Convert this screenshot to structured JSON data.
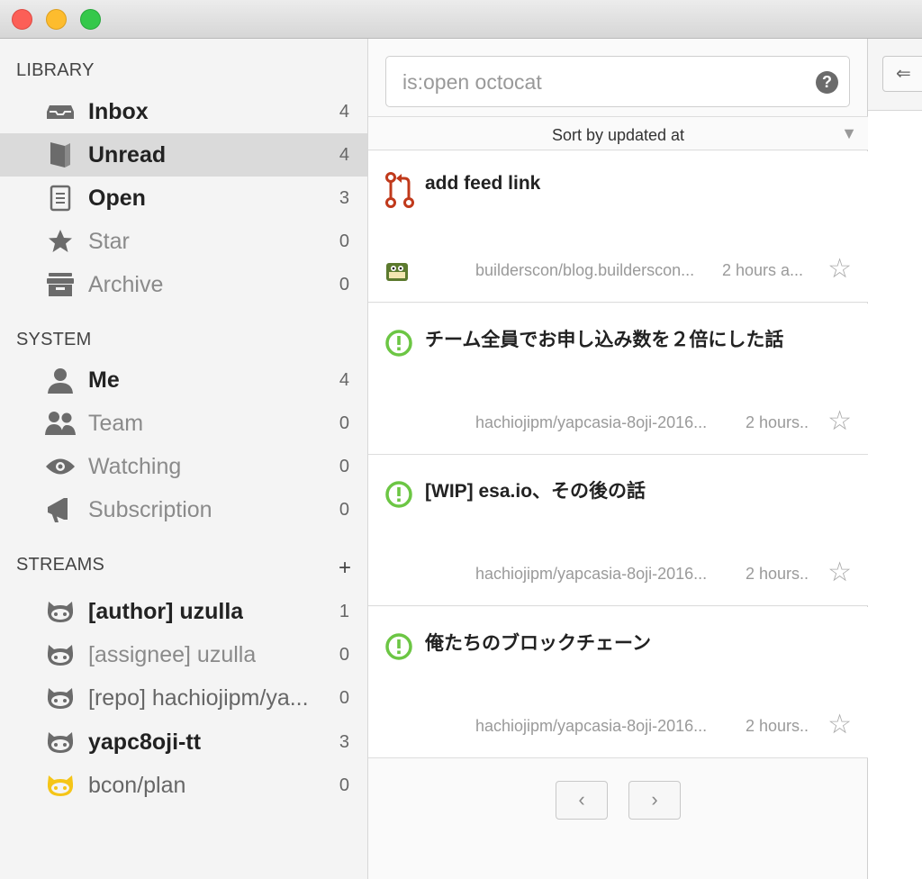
{
  "sidebar": {
    "library": {
      "title": "LIBRARY",
      "items": [
        {
          "label": "Inbox",
          "count": "4",
          "icon": "inbox-icon"
        },
        {
          "label": "Unread",
          "count": "4",
          "icon": "book-icon"
        },
        {
          "label": "Open",
          "count": "3",
          "icon": "document-icon"
        },
        {
          "label": "Star",
          "count": "0",
          "icon": "star-icon"
        },
        {
          "label": "Archive",
          "count": "0",
          "icon": "archive-box-icon"
        }
      ]
    },
    "system": {
      "title": "SYSTEM",
      "items": [
        {
          "label": "Me",
          "count": "4",
          "icon": "person-icon"
        },
        {
          "label": "Team",
          "count": "0",
          "icon": "people-icon"
        },
        {
          "label": "Watching",
          "count": "0",
          "icon": "eye-icon"
        },
        {
          "label": "Subscription",
          "count": "0",
          "icon": "megaphone-icon"
        }
      ]
    },
    "streams": {
      "title": "STREAMS",
      "add": "+",
      "items": [
        {
          "label": "[author] uzulla",
          "count": "1",
          "icon": "octocat-icon"
        },
        {
          "label": "[assignee] uzulla",
          "count": "0",
          "icon": "octocat-icon"
        },
        {
          "label": "[repo] hachiojipm/ya...",
          "count": "0",
          "icon": "octocat-icon"
        },
        {
          "label": "yapc8oji-tt",
          "count": "3",
          "icon": "octocat-icon"
        },
        {
          "label": "bcon/plan",
          "count": "0",
          "icon": "octocat-icon"
        }
      ]
    }
  },
  "search": {
    "value": "is:open octocat",
    "help": "?"
  },
  "sort": {
    "label": "Sort by updated at",
    "arrow": "▼"
  },
  "issues": [
    {
      "title": "add feed link",
      "repo": "builderscon/blog.builderscon...",
      "time": "2 hours a...",
      "icon": "pull-request-icon",
      "star": "☆"
    },
    {
      "title": "チーム全員でお申し込み数を２倍にした話",
      "repo": "hachiojipm/yapcasia-8oji-2016...",
      "time": "2 hours..",
      "icon": "issue-open-icon",
      "star": "☆"
    },
    {
      "title": "[WIP] esa.io、その後の話",
      "repo": "hachiojipm/yapcasia-8oji-2016...",
      "time": "2 hours..",
      "icon": "issue-open-icon",
      "star": "☆"
    },
    {
      "title": "俺たちのブロックチェーン",
      "repo": "hachiojipm/yapcasia-8oji-2016...",
      "time": "2 hours..",
      "icon": "issue-open-icon",
      "star": "☆"
    }
  ],
  "pager": {
    "prev": "‹",
    "next": "›"
  },
  "detail": {
    "back": "⇐"
  },
  "colors": {
    "selected_row": "#dadada",
    "pr_icon": "#c0391b",
    "issue_open": "#6cc644",
    "stream_highlight": "#f5c518"
  }
}
